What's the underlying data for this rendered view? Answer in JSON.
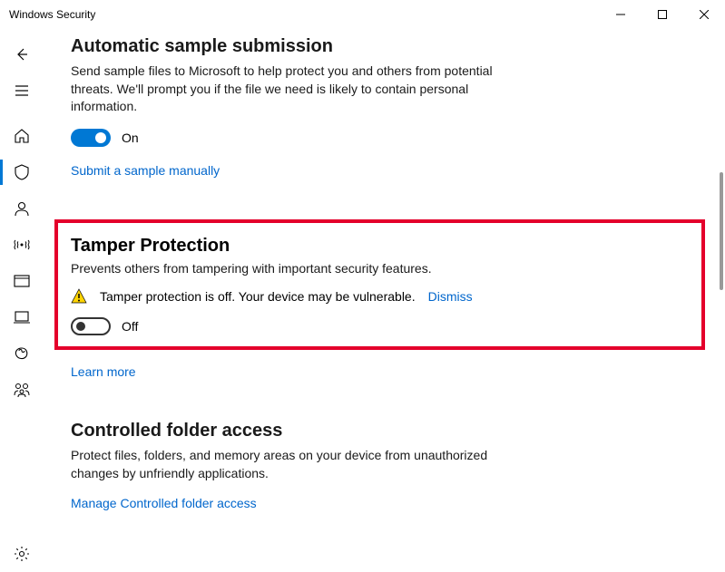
{
  "window": {
    "title": "Windows Security"
  },
  "sections": {
    "auto_sample": {
      "title": "Automatic sample submission",
      "desc": "Send sample files to Microsoft to help protect you and others from potential threats. We'll prompt you if the file we need is likely to contain personal information.",
      "toggle_state": "On",
      "link": "Submit a sample manually"
    },
    "tamper": {
      "title": "Tamper Protection",
      "desc": "Prevents others from tampering with important security features.",
      "warning": "Tamper protection is off. Your device may be vulnerable.",
      "dismiss": "Dismiss",
      "toggle_state": "Off",
      "link": "Learn more"
    },
    "controlled_folder": {
      "title": "Controlled folder access",
      "desc": "Protect files, folders, and memory areas on your device from unauthorized changes by unfriendly applications.",
      "link": "Manage Controlled folder access"
    }
  }
}
